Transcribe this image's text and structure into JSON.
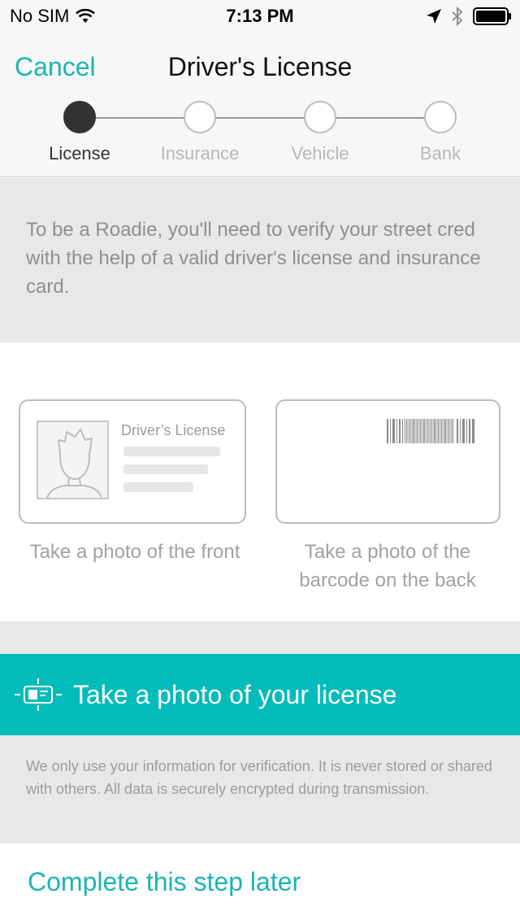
{
  "status_bar": {
    "carrier": "No SIM",
    "time": "7:13 PM"
  },
  "nav": {
    "cancel_label": "Cancel",
    "title": "Driver's License"
  },
  "steps": [
    {
      "label": "License",
      "active": true
    },
    {
      "label": "Insurance",
      "active": false
    },
    {
      "label": "Vehicle",
      "active": false
    },
    {
      "label": "Bank",
      "active": false
    }
  ],
  "intro": {
    "text": "To be a Roadie, you'll need to verify your street cred with the help of a valid driver's license and insurance card."
  },
  "cards": {
    "front_title": "Driver’s License",
    "front_caption": "Take a photo of the front",
    "back_caption": "Take a photo of the barcode on the back"
  },
  "cta": {
    "label": "Take a photo of your license",
    "icon": "camera-frame-icon"
  },
  "disclaimer": {
    "text": "We only use your information for verification. It is never stored or shared with others. All data is securely encrypted during transmission."
  },
  "later": {
    "label": "Complete this step later"
  },
  "colors": {
    "accent": "#1bb5b3",
    "cta_bg": "#02bcbb",
    "active_step": "#333231",
    "panel_gray": "#e8e8e9"
  }
}
